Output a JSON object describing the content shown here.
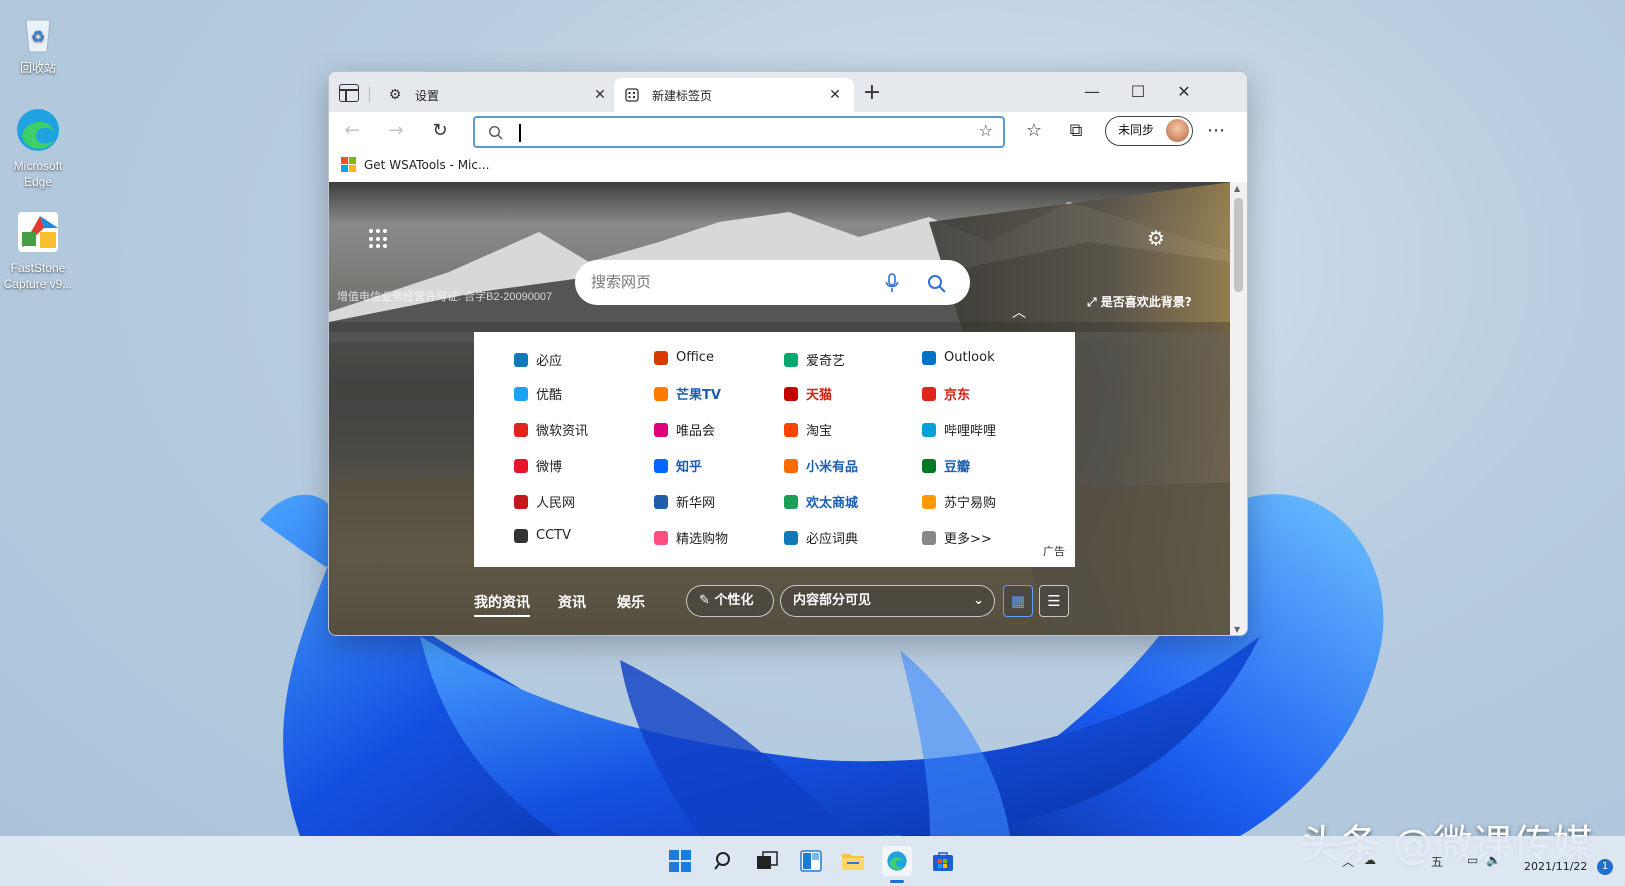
{
  "desktop": {
    "icons": [
      {
        "label": "回收站",
        "icon": "recycle-bin-icon"
      },
      {
        "label": "Microsoft Edge",
        "icon": "edge-icon"
      },
      {
        "label": "FastStone Capture v9...",
        "icon": "faststone-icon"
      }
    ]
  },
  "browser": {
    "tabs": [
      {
        "label": "设置",
        "icon": "gear-icon",
        "active": false
      },
      {
        "label": "新建标签页",
        "icon": "newtab-page-icon",
        "active": true
      }
    ],
    "address": {
      "value": ""
    },
    "profile_label": "未同步",
    "favorites": [
      {
        "label": "Get WSATools - Mic..."
      }
    ],
    "new_tab": {
      "license_text": "增值电信业务经营许可证: 合字B2-20090007",
      "search_placeholder": "搜索网页",
      "like_bg": "是否喜欢此背景?",
      "ad_label": "广告",
      "quicklinks": [
        [
          "必应",
          "Office",
          "爱奇艺",
          "Outlook"
        ],
        [
          "优酷",
          "芒果TV",
          "天猫",
          "京东"
        ],
        [
          "微软资讯",
          "唯品会",
          "淘宝",
          "哔哩哔哩"
        ],
        [
          "微博",
          "知乎",
          "小米有品",
          "豆瓣"
        ],
        [
          "人民网",
          "新华网",
          "欢太商城",
          "苏宁易购"
        ],
        [
          "CCTV",
          "精选购物",
          "必应词典",
          "更多>>"
        ]
      ],
      "feed_tabs": [
        "我的资讯",
        "资讯",
        "娱乐"
      ],
      "personalize": "个性化",
      "visibility": "内容部分可见"
    }
  },
  "taskbar": {
    "clock": "2021/11/22",
    "notifications": "1",
    "ime": "五"
  },
  "watermark": "头条 @微课传媒",
  "colors": {
    "accent": "#1e6fd0",
    "address_border": "#5b9bd5"
  }
}
